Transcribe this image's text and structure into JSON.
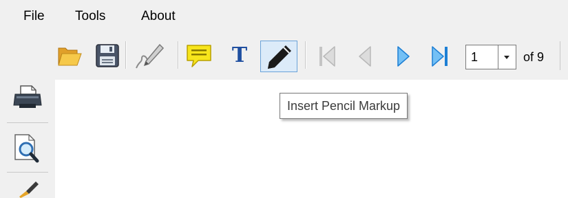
{
  "menu": {
    "file": "File",
    "tools": "Tools",
    "about": "About"
  },
  "toolbar": {
    "icons": [
      "open-folder-icon",
      "save-icon",
      "signature-icon",
      "comment-icon",
      "text-icon",
      "pencil-icon",
      "first-page-icon",
      "previous-page-icon",
      "next-page-icon",
      "last-page-icon"
    ],
    "text_tool_glyph": "T",
    "active_tool": "pencil",
    "page": {
      "current": "1",
      "of_label": "of 9"
    }
  },
  "sidebar": {
    "icons": [
      "print-icon",
      "print-preview-icon",
      "brush-icon"
    ]
  },
  "tooltip": {
    "text": "Insert Pencil Markup"
  },
  "colors": {
    "chrome": "#f0f0f0",
    "active_tool_bg": "#dcebf9",
    "active_tool_border": "#6aa2d8",
    "nav_enabled": "#2e8fe0",
    "nav_disabled": "#c4c4c4",
    "comment_yellow": "#f7e51c"
  }
}
